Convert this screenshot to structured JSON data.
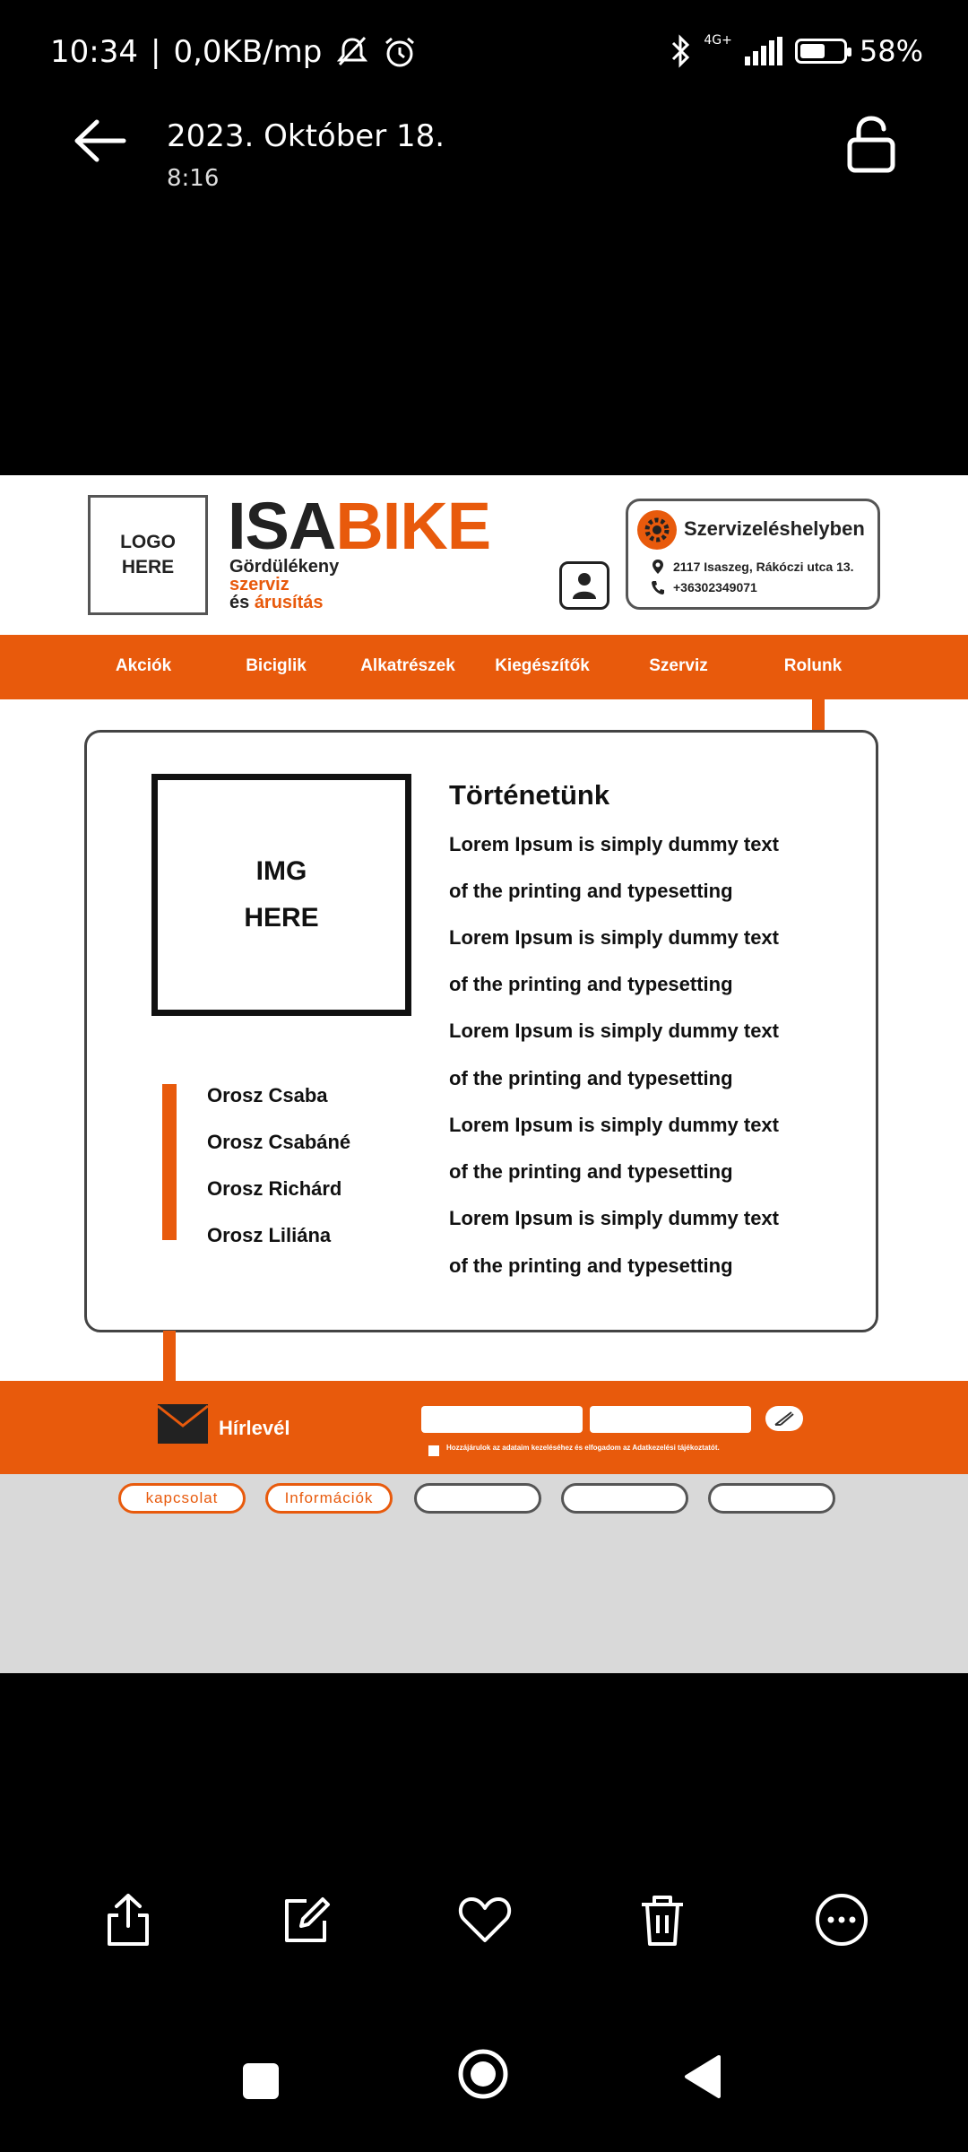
{
  "status_bar": {
    "time": "10:34",
    "separator": "|",
    "network_speed": "0,0KB/mp",
    "network_type": "4G+",
    "battery": "58%",
    "battery_level": 0.58,
    "icons": [
      "mute-icon",
      "alarm-icon",
      "bluetooth-icon",
      "signal-icon",
      "battery-icon"
    ]
  },
  "viewer": {
    "date": "2023. Október 18.",
    "time": "8:16"
  },
  "mockup": {
    "logo_line1": "LOGO",
    "logo_line2": "HERE",
    "brand_part1": "ISA",
    "brand_part2": "BIKE",
    "tagline_1": "Gördülékeny",
    "tagline_2": "szerviz",
    "tagline_3a": "és",
    "tagline_3b": "árusítás",
    "service_title": "Szervizeléshelyben",
    "address": "2117 Isaszeg, Rákóczi utca 13.",
    "phone": "+36302349071",
    "nav": [
      "Akciók",
      "Biciglik",
      "Alkatrészek",
      "Kiegészítők",
      "Szerviz",
      "Rolunk"
    ],
    "img_line1": "IMG",
    "img_line2": "HERE",
    "story_title": "Történetünk",
    "story_lines": [
      "Lorem Ipsum is simply dummy text",
      "of the printing and typesetting",
      "Lorem Ipsum is simply dummy text",
      "of the printing and typesetting",
      "Lorem Ipsum is simply dummy text",
      "of the printing and typesetting",
      "Lorem Ipsum is simply dummy text",
      "of the printing and typesetting",
      "Lorem Ipsum is simply dummy text",
      "of the printing and typesetting"
    ],
    "team": [
      "Orosz Csaba",
      "Orosz Csabáné",
      "Orosz Richárd",
      "Orosz Liliána"
    ],
    "newsletter": "Hírlevél",
    "consent": "Hozzájárulok az adataim kezeléséhez és elfogadom az Adatkezelési tájékoztatót.",
    "footer_links": [
      "kapcsolat",
      "Információk",
      "",
      "",
      ""
    ],
    "accent_color": "#e85a0c"
  },
  "toolbar": [
    "share-icon",
    "edit-icon",
    "favorite-icon",
    "delete-icon",
    "more-icon"
  ],
  "system_nav": [
    "recents-icon",
    "home-icon",
    "back-nav-icon"
  ]
}
